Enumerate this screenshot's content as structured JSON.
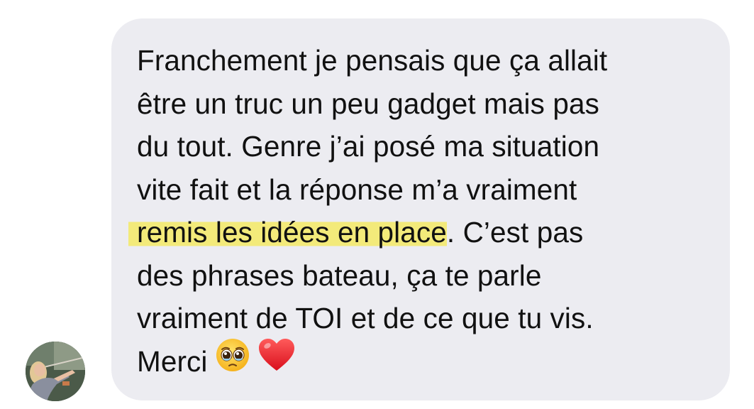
{
  "message": {
    "lines": [
      "Franchement je pensais que ça allait",
      "être un truc un peu gadget mais pas",
      "du tout. Genre j’ai posé ma situation",
      "vite fait et la réponse m’a vraiment"
    ],
    "highlighted": "remis les idées en place",
    "after_highlight": ". C’est pas",
    "lines_after": [
      "des phrases bateau, ça te parle",
      "vraiment de TOI et de ce que tu vis."
    ],
    "closing": "Merci",
    "emojis": [
      "pleading-face-emoji",
      "red-heart-emoji"
    ],
    "highlight_color": "#f3ea7a"
  },
  "colors": {
    "bubble": "#ececf1",
    "text": "#111111",
    "background": "#ffffff"
  }
}
